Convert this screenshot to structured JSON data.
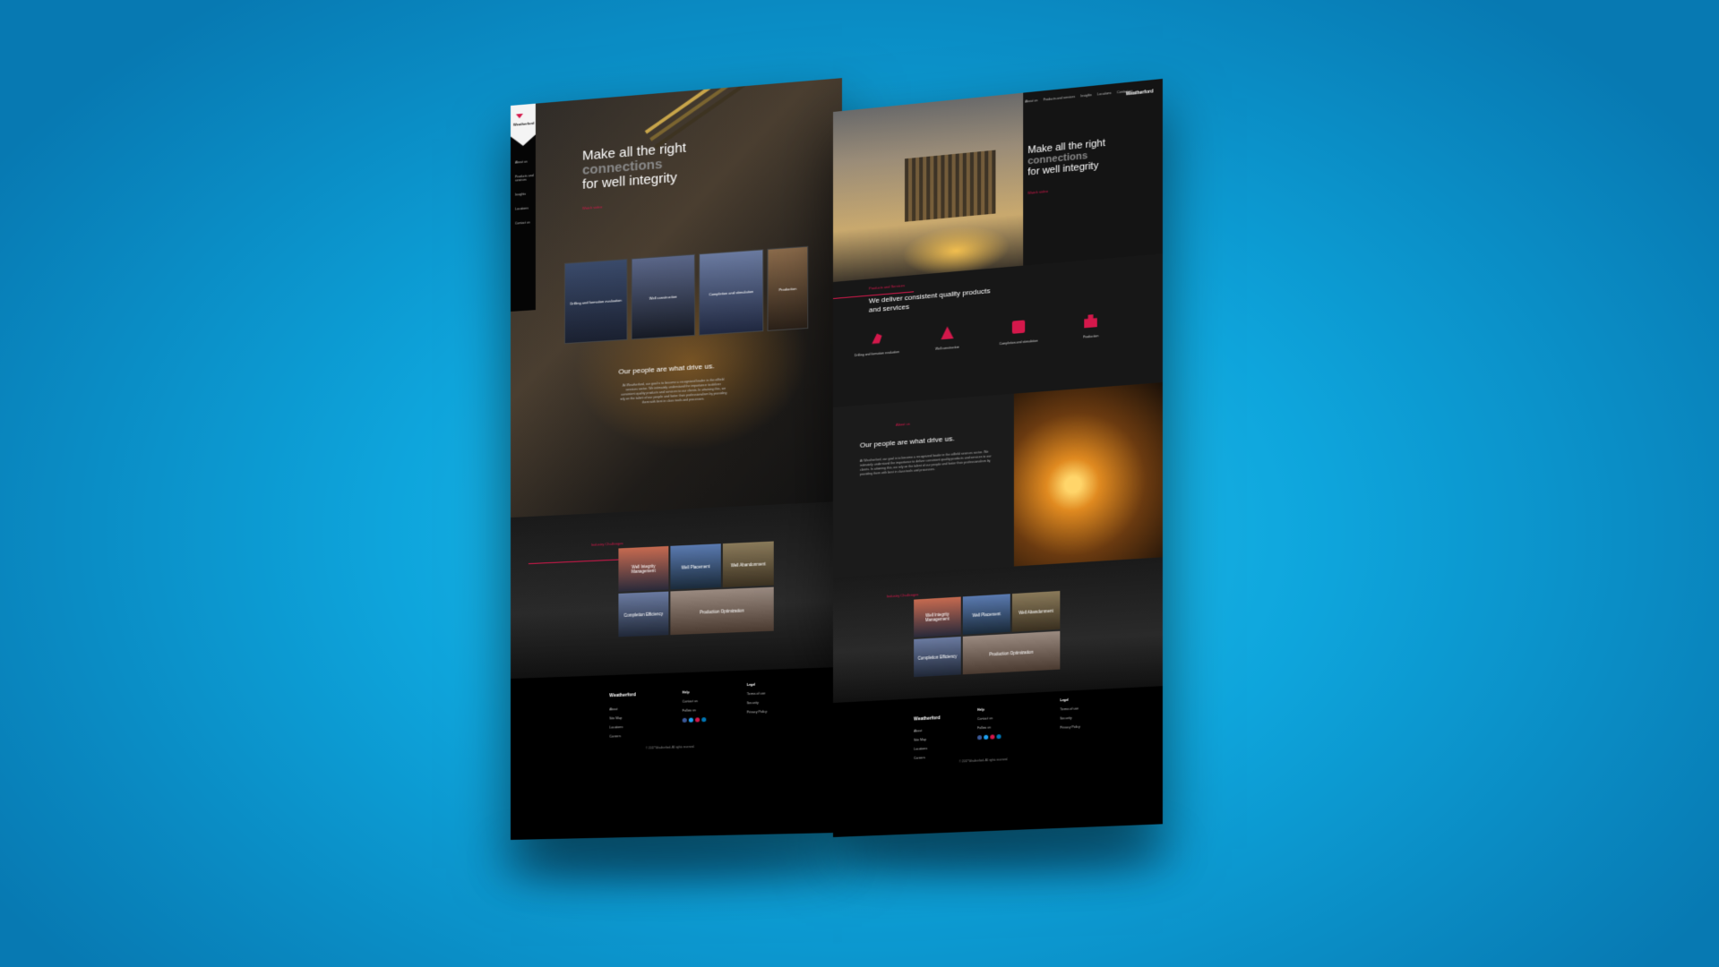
{
  "left_page": {
    "logo_text": "Weatherford",
    "side_nav": [
      "About us",
      "Products and services",
      "Insights",
      "Locations",
      "Contact us"
    ],
    "hero": {
      "title_line1": "Make all the right",
      "title_line2": "connections",
      "title_line3": "for well integrity",
      "cta": "Watch video"
    },
    "tiles": [
      "Drilling and formation evaluation",
      "Well construction",
      "Completion and stimulation",
      "Production"
    ],
    "people": {
      "title": "Our people are what drive us.",
      "text": "At Weatherford, our goal is to become a recognized leader in the oilfield services sector. We intimately understand the importance to deliver consistent quality products and services to our clients. In attaining this, we rely on the talent of our people and foster their professionalism by providing them with best in class tools and processes."
    },
    "challenges": {
      "label": "Industry Challenges",
      "items": [
        "Well Integrity Management",
        "Well Placement",
        "Well Abandonment",
        "Completion Efficiency",
        "Production Optimization"
      ]
    },
    "footer": {
      "logo": "Weatherford",
      "col1": [
        "About",
        "Site Map",
        "Locations",
        "Careers"
      ],
      "help_title": "Help",
      "help_items": [
        "Contact us"
      ],
      "follow": "Follow us",
      "legal_title": "Legal",
      "legal_items": [
        "Terms of use",
        "Security",
        "Privacy Policy"
      ],
      "copyright": "© 2017 Weatherford. All rights reserved."
    }
  },
  "right_page": {
    "nav": [
      "About us",
      "Products and services",
      "Insights",
      "Locations",
      "Contact us"
    ],
    "logo_text": "Weatherford",
    "hero": {
      "title_line1": "Make all the right",
      "title_line2": "connections",
      "title_line3": "for well integrity",
      "cta": "Watch video"
    },
    "products": {
      "label": "Products and Services",
      "title": "We deliver consistent quality products and services",
      "items": [
        "Drilling and formation evaluation",
        "Well construction",
        "Completion and stimulation",
        "Production"
      ]
    },
    "about": {
      "label": "About us",
      "title": "Our people are what drive us.",
      "text": "At Weatherford, our goal is to become a recognized leader in the oilfield services sector. We intimately understand the importance to deliver consistent quality products and services to our clients. In attaining this, we rely on the talent of our people and foster their professionalism by providing them with best in class tools and processes."
    },
    "challenges": {
      "label": "Industry Challenges",
      "items": [
        "Well Integrity Management",
        "Well Placement",
        "Well Abandonment",
        "Completion Efficiency",
        "Production Optimization"
      ]
    },
    "footer": {
      "logo": "Weatherford",
      "col1": [
        "About",
        "Site Map",
        "Locations",
        "Careers"
      ],
      "help_title": "Help",
      "help_items": [
        "Contact us"
      ],
      "follow": "Follow us",
      "legal_title": "Legal",
      "legal_items": [
        "Terms of use",
        "Security",
        "Privacy Policy"
      ],
      "copyright": "© 2017 Weatherford. All rights reserved."
    }
  },
  "colors": {
    "accent": "#d4184b",
    "background_center": "#22c3f0",
    "background_edge": "#0779b2",
    "page_bg": "#141414"
  }
}
